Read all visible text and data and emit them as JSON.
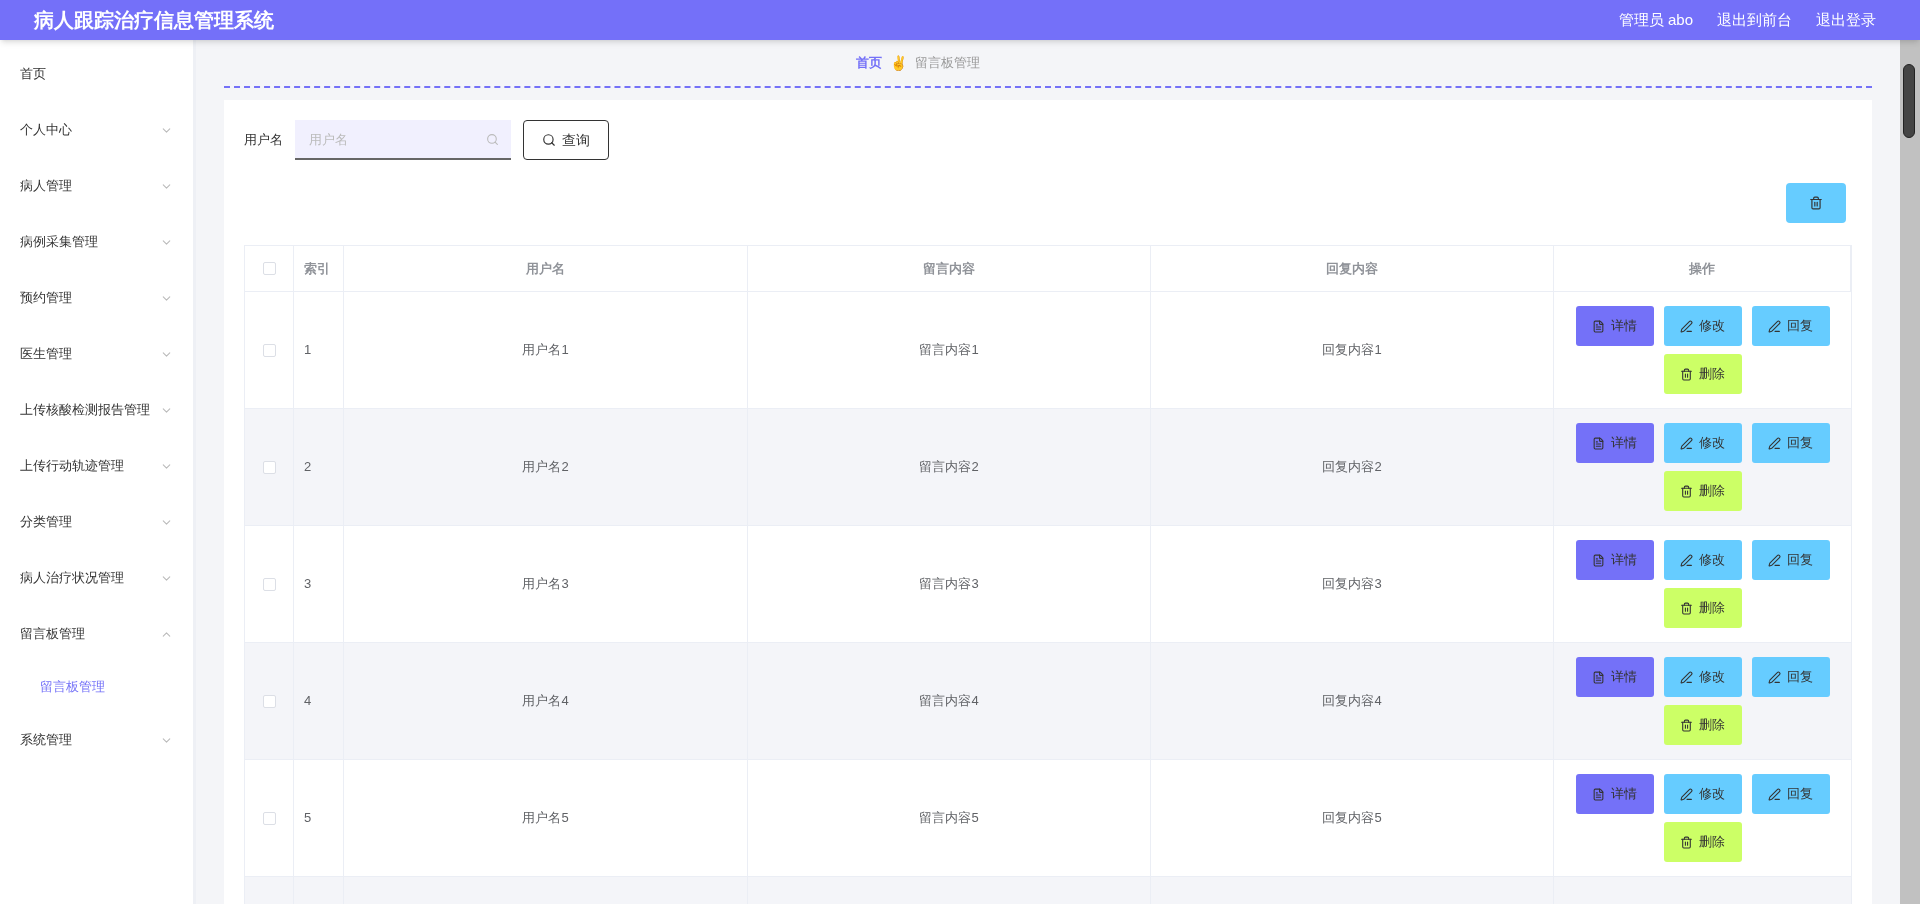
{
  "header": {
    "title": "病人跟踪治疗信息管理系统",
    "user": "管理员 abo",
    "links": [
      "退出到前台",
      "退出登录"
    ]
  },
  "sidebar": {
    "items": [
      {
        "label": "首页"
      },
      {
        "label": "个人中心",
        "expanded": false
      },
      {
        "label": "病人管理",
        "expanded": false
      },
      {
        "label": "病例采集管理",
        "expanded": false
      },
      {
        "label": "预约管理",
        "expanded": false
      },
      {
        "label": "医生管理",
        "expanded": false
      },
      {
        "label": "上传核酸检测报告管理",
        "expanded": false
      },
      {
        "label": "上传行动轨迹管理",
        "expanded": false
      },
      {
        "label": "分类管理",
        "expanded": false
      },
      {
        "label": "病人治疗状况管理",
        "expanded": false
      },
      {
        "label": "留言板管理",
        "expanded": true,
        "children": [
          {
            "label": "留言板管理",
            "selected": true
          }
        ]
      },
      {
        "label": "系统管理",
        "expanded": false
      }
    ]
  },
  "breadcrumb": {
    "home": "首页",
    "separator": "✌️",
    "current": "留言板管理"
  },
  "search": {
    "label": "用户名",
    "placeholder": "用户名",
    "button": "查询"
  },
  "table": {
    "all_checked": false,
    "columns": [
      "索引",
      "用户名",
      "留言内容",
      "回复内容",
      "操作"
    ],
    "rows": [
      {
        "checked": false,
        "cells": [
          "1",
          "用户名1",
          "留言内容1",
          "回复内容1"
        ],
        "actions": [
          {
            "kind": "detail",
            "label": "详情"
          },
          {
            "kind": "edit",
            "label": "修改"
          },
          {
            "kind": "reply",
            "label": "回复"
          },
          {
            "kind": "delete",
            "label": "删除"
          }
        ]
      },
      {
        "checked": false,
        "cells": [
          "2",
          "用户名2",
          "留言内容2",
          "回复内容2"
        ],
        "actions": [
          {
            "kind": "detail",
            "label": "详情"
          },
          {
            "kind": "edit",
            "label": "修改"
          },
          {
            "kind": "reply",
            "label": "回复"
          },
          {
            "kind": "delete",
            "label": "删除"
          }
        ]
      },
      {
        "checked": false,
        "cells": [
          "3",
          "用户名3",
          "留言内容3",
          "回复内容3"
        ],
        "actions": [
          {
            "kind": "detail",
            "label": "详情"
          },
          {
            "kind": "edit",
            "label": "修改"
          },
          {
            "kind": "reply",
            "label": "回复"
          },
          {
            "kind": "delete",
            "label": "删除"
          }
        ]
      },
      {
        "checked": false,
        "cells": [
          "4",
          "用户名4",
          "留言内容4",
          "回复内容4"
        ],
        "actions": [
          {
            "kind": "detail",
            "label": "详情"
          },
          {
            "kind": "edit",
            "label": "修改"
          },
          {
            "kind": "reply",
            "label": "回复"
          },
          {
            "kind": "delete",
            "label": "删除"
          }
        ]
      },
      {
        "checked": false,
        "cells": [
          "5",
          "用户名5",
          "留言内容5",
          "回复内容5"
        ],
        "actions": [
          {
            "kind": "detail",
            "label": "详情"
          },
          {
            "kind": "edit",
            "label": "修改"
          },
          {
            "kind": "reply",
            "label": "回复"
          },
          {
            "kind": "delete",
            "label": "删除"
          }
        ]
      }
    ]
  }
}
